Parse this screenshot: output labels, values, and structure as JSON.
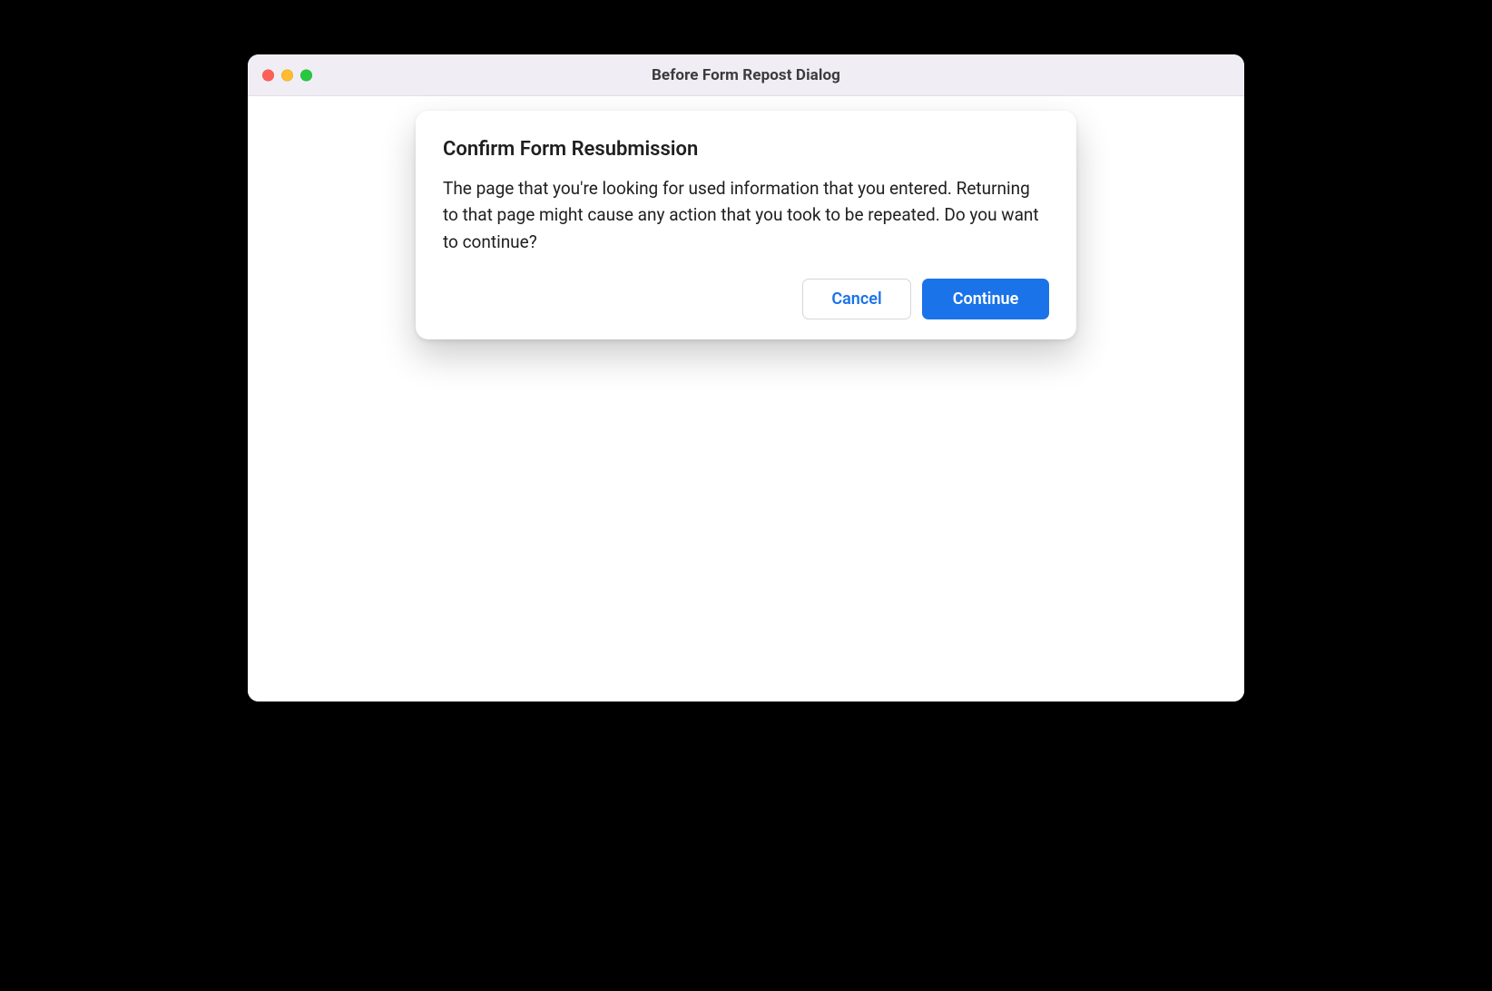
{
  "window": {
    "title": "Before Form Repost Dialog"
  },
  "dialog": {
    "heading": "Confirm Form Resubmission",
    "body": "The page that you're looking for used information that you entered. Returning to that page might cause any action that you took to be repeated. Do you want to continue?",
    "actions": {
      "cancel": "Cancel",
      "continue": "Continue"
    }
  }
}
